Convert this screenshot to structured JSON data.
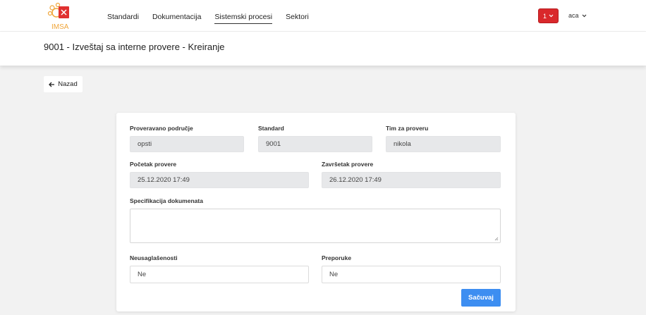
{
  "brand": {
    "logo_text": "IMSA"
  },
  "nav": {
    "items": [
      "Standardi",
      "Dokumentacija",
      "Sistemski procesi",
      "Sektori"
    ],
    "active": "Sistemski procesi"
  },
  "notifications": {
    "count": "1"
  },
  "user": {
    "name": "aca"
  },
  "page": {
    "title": "9001 - Izveštaj sa interne provere - Kreiranje"
  },
  "back": {
    "label": "Nazad"
  },
  "form": {
    "area_label": "Proveravano područje",
    "area_value": "opsti",
    "standard_label": "Standard",
    "standard_value": "9001",
    "team_label": "Tim za proveru",
    "team_value": "nikola",
    "start_label": "Početak provere",
    "start_value": "25.12.2020 17:49",
    "end_label": "Završetak provere",
    "end_value": "26.12.2020 17:49",
    "spec_label": "Specifikacija dokumenata",
    "spec_value": "",
    "nonconf_label": "Neusaglašenosti",
    "nonconf_value": "Ne",
    "recomm_label": "Preporuke",
    "recomm_value": "Ne",
    "save_label": "Sačuvaj"
  },
  "colors": {
    "accent": "#3d8ef1",
    "danger": "#d9282b",
    "logo_orange": "#f0a63b"
  }
}
